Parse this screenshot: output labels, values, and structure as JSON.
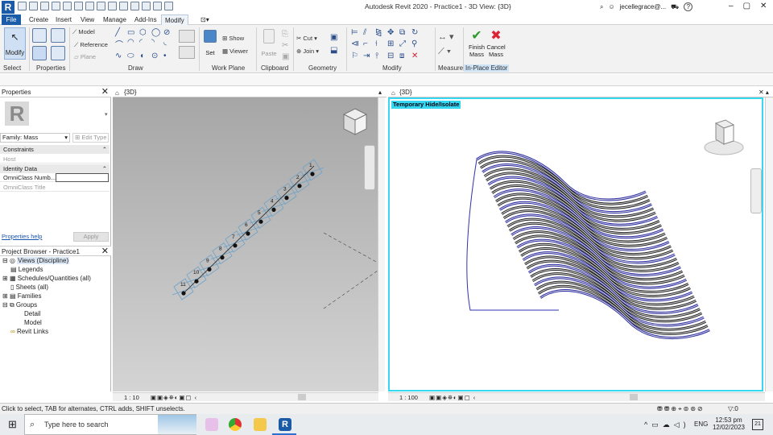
{
  "app": {
    "title": "Autodesk Revit 2020 - Practice1 - 3D View: {3D}",
    "user": "jecellegrace@...",
    "help": "?"
  },
  "menu": {
    "tabs": [
      "File",
      "Create",
      "Insert",
      "View",
      "Manage",
      "Add-Ins",
      "Modify"
    ]
  },
  "ribbon": {
    "panels": {
      "select": "Select",
      "properties": "Properties",
      "draw": "Draw",
      "work_plane": "Work Plane",
      "clipboard": "Clipboard",
      "geometry": "Geometry",
      "modify": "Modify",
      "measure": "Measure",
      "inplace": "In-Place Editor"
    },
    "buttons": {
      "modify": "Modify",
      "model": "Model",
      "reference": "Reference",
      "plane": "Plane",
      "set": "Set",
      "show": "Show",
      "viewer": "Viewer",
      "paste": "Paste",
      "cut": "Cut",
      "join": "Join",
      "finish_mass_1": "Finish",
      "finish_mass_2": "Mass",
      "cancel_mass_1": "Cancel",
      "cancel_mass_2": "Mass"
    }
  },
  "properties": {
    "header": "Properties",
    "family": "Family: Mass",
    "edit_type": "Edit Type",
    "sections": {
      "constraints": "Constraints",
      "identity": "Identity Data"
    },
    "rows": {
      "host": "Host",
      "omni_number": "OmniClass Numb...",
      "omni_title": "OmniClass Title"
    },
    "help_link": "Properties help",
    "apply": "Apply"
  },
  "browser": {
    "header": "Project Browser - Practice1",
    "items": {
      "views": "Views (Discipline)",
      "legends": "Legends",
      "schedules": "Schedules/Quantities (all)",
      "sheets": "Sheets (all)",
      "families": "Families",
      "groups": "Groups",
      "detail": "Detail",
      "model": "Model",
      "revit_links": "Revit Links"
    }
  },
  "views": {
    "left": {
      "tab": "{3D}",
      "scale": "1 : 10",
      "numbers": [
        "1",
        "2",
        "3",
        "4",
        "5",
        "6",
        "7",
        "8",
        "9",
        "10",
        "11"
      ]
    },
    "right": {
      "tab": "{3D}",
      "scale": "1 : 100",
      "temp_label": "Temporary Hide/Isolate"
    },
    "viewcube": {
      "top": "TOP",
      "front": "FRONT",
      "right": "RIGHT"
    }
  },
  "status": {
    "text": "Click to select, TAB for alternates, CTRL adds, SHIFT unselects.",
    "filter_count": ":0"
  },
  "taskbar": {
    "search_placeholder": "Type here to search",
    "lang": "ENG",
    "time": "12:53 pm",
    "date": "12/02/2023",
    "notif": "21"
  }
}
